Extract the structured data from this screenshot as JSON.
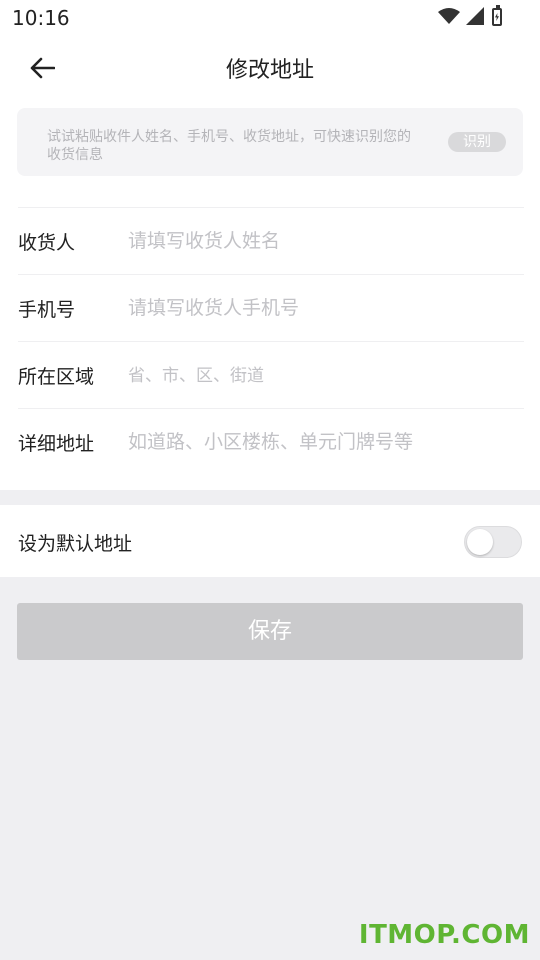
{
  "status_bar": {
    "time": "10:16"
  },
  "header": {
    "title": "修改地址",
    "back_icon": "arrow-left-icon"
  },
  "paste_box": {
    "placeholder": "试试粘贴收件人姓名、手机号、收货地址，可快速识别您的收货信息",
    "recognize_label": "识别"
  },
  "form": {
    "fields": [
      {
        "label": "收货人",
        "placeholder": "请填写收货人姓名",
        "value": ""
      },
      {
        "label": "手机号",
        "placeholder": "请填写收货人手机号",
        "value": ""
      },
      {
        "label": "所在区域",
        "placeholder": "省、市、区、街道",
        "value": ""
      },
      {
        "label": "详细地址",
        "placeholder": "如道路、小区楼栋、单元门牌号等",
        "value": ""
      }
    ]
  },
  "default_address": {
    "label": "设为默认地址",
    "enabled": false
  },
  "save_button": {
    "label": "保存"
  },
  "watermark": {
    "text": "ITMOP.COM"
  },
  "colors": {
    "watermark": "#5fb533",
    "save_disabled": "#cacacc",
    "background": "#efeff2"
  }
}
